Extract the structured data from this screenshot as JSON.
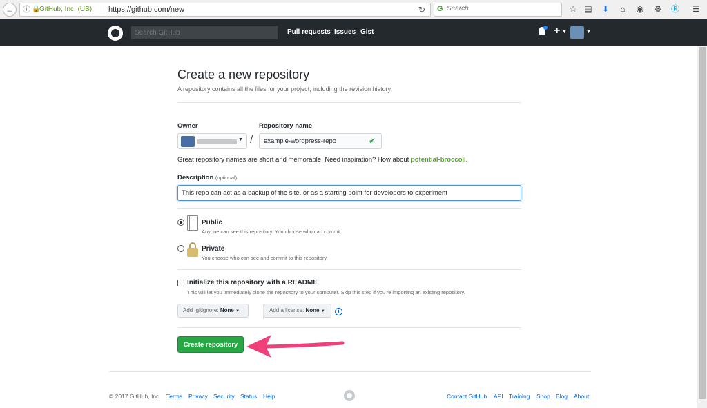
{
  "browser": {
    "back_icon": "back-arrow-icon",
    "secure_label": "GitHub, Inc. (US)",
    "url": "https://github.com/new",
    "search_placeholder": "Search"
  },
  "header": {
    "search_placeholder": "Search GitHub",
    "nav": [
      "Pull requests",
      "Issues",
      "Gist"
    ]
  },
  "form": {
    "title": "Create a new repository",
    "subtitle": "A repository contains all the files for your project, including the revision history.",
    "owner_label": "Owner",
    "repo_label": "Repository name",
    "repo_value": "example-wordpress-repo",
    "help_text": "Great repository names are short and memorable. Need inspiration? How about ",
    "suggestion": "potential-broccoli",
    "suggestion_end": ".",
    "description_label": "Description",
    "description_optional": "(optional)",
    "description_value": "This repo can act as a backup of the site, or as a starting point for developers to experiment",
    "public_title": "Public",
    "public_desc": "Anyone can see this repository. You choose who can commit.",
    "private_title": "Private",
    "private_desc": "You choose who can see and commit to this repository.",
    "visibility": "public",
    "init_title": "Initialize this repository with a README",
    "init_desc": "This will let you immediately clone the repository to your computer. Skip this step if you're importing an existing repository.",
    "gitignore_label": "Add .gitignore:",
    "gitignore_value": "None",
    "license_label": "Add a license:",
    "license_value": "None",
    "create_button": "Create repository"
  },
  "footer": {
    "copyright": "© 2017 GitHub, Inc.",
    "left_links": [
      "Terms",
      "Privacy",
      "Security",
      "Status",
      "Help"
    ],
    "right_links": [
      "Contact GitHub",
      "API",
      "Training",
      "Shop",
      "Blog",
      "About"
    ]
  },
  "colors": {
    "header_bg": "#24292e",
    "primary_button": "#28a745",
    "annotation_arrow": "#f0407a",
    "link": "#0366d6"
  }
}
